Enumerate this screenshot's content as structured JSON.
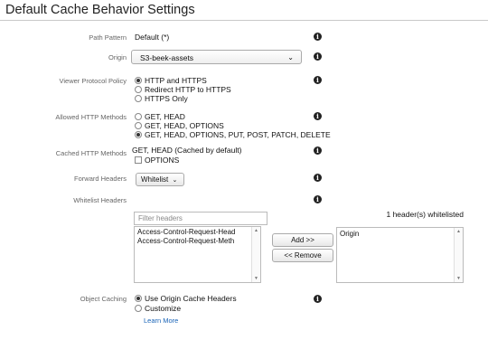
{
  "page": {
    "title": "Default Cache Behavior Settings"
  },
  "fields": {
    "path_pattern": {
      "label": "Path Pattern",
      "value": "Default (*)"
    },
    "origin": {
      "label": "Origin",
      "value": "S3-beek-assets"
    },
    "viewer_protocol": {
      "label": "Viewer Protocol Policy",
      "options": [
        "HTTP and HTTPS",
        "Redirect HTTP to HTTPS",
        "HTTPS Only"
      ],
      "selected": 0
    },
    "allowed_methods": {
      "label": "Allowed HTTP Methods",
      "options": [
        "GET, HEAD",
        "GET, HEAD, OPTIONS",
        "GET, HEAD, OPTIONS, PUT, POST, PATCH, DELETE"
      ],
      "selected": 2
    },
    "cached_methods": {
      "label": "Cached HTTP Methods",
      "value": "GET, HEAD (Cached by default)",
      "option_label": "OPTIONS",
      "option_checked": false
    },
    "forward_headers": {
      "label": "Forward Headers",
      "value": "Whitelist"
    },
    "whitelist_headers": {
      "label": "Whitelist Headers",
      "filter_placeholder": "Filter headers",
      "available": [
        "Access-Control-Request-Head",
        "Access-Control-Request-Meth"
      ],
      "whitelisted": [
        "Origin"
      ],
      "count_text": "1 header(s) whitelisted",
      "add_label": "Add >>",
      "remove_label": "<< Remove"
    },
    "object_caching": {
      "label": "Object Caching",
      "options": [
        "Use Origin Cache Headers",
        "Customize"
      ],
      "selected": 0,
      "learn_more": "Learn More"
    }
  },
  "icons": {
    "info": "info-icon",
    "dropdown": "chevron-down-icon",
    "scroll_up": "scroll-up-arrow-icon",
    "scroll_down": "scroll-down-arrow-icon"
  },
  "colors": {
    "link": "#1a64b7",
    "info_icon": "#222222",
    "label": "#666666"
  }
}
